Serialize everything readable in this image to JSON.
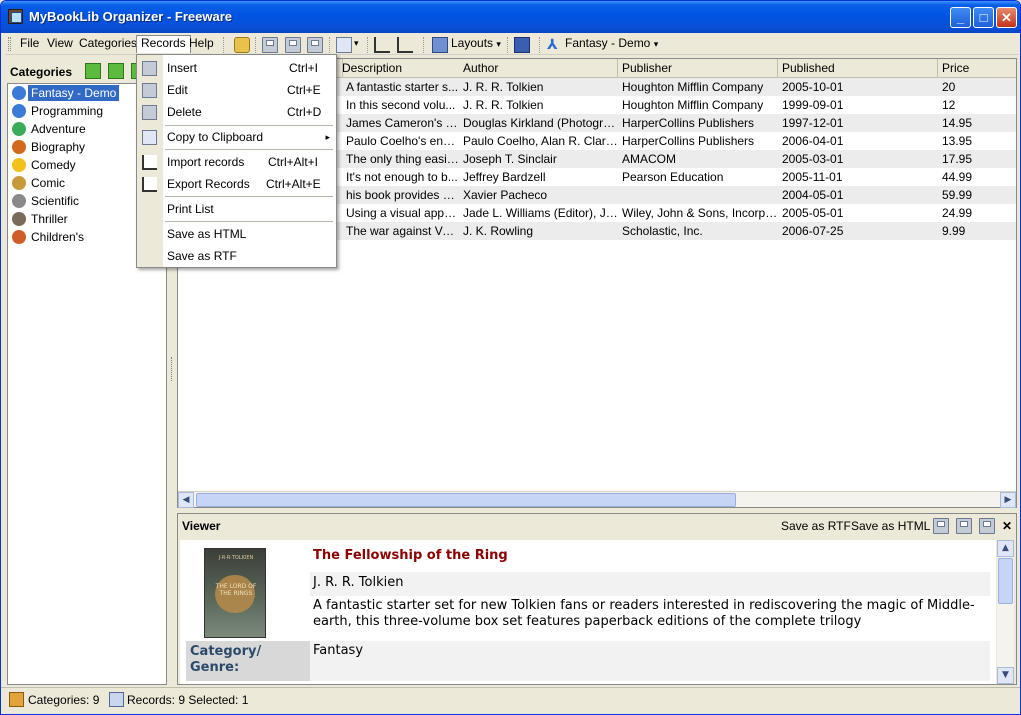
{
  "window": {
    "title": "MyBookLib Organizer - Freeware",
    "minimize": "_",
    "maximize": "□",
    "close": "✕"
  },
  "menu": {
    "file": "File",
    "view": "View",
    "categories": "Categories",
    "records": "Records",
    "help": "Help"
  },
  "toolbar": {
    "layouts": "Layouts",
    "layout_dropdown": "▾",
    "current_category": "Fantasy - Demo",
    "category_dropdown": "▾"
  },
  "left_panel": {
    "header": "Categories",
    "items": [
      {
        "label": "Fantasy - Demo",
        "selected": true,
        "icon": "fantasy-icon",
        "color": "#3b7ad6"
      },
      {
        "label": "Programming",
        "icon": "programming-icon",
        "color": "#3b7ad6"
      },
      {
        "label": "Adventure",
        "icon": "adventure-icon",
        "color": "#3bab5a"
      },
      {
        "label": "Biography",
        "icon": "biography-icon",
        "color": "#d26a1c"
      },
      {
        "label": "Comedy",
        "icon": "comedy-icon",
        "color": "#f2c21a"
      },
      {
        "label": "Comic",
        "icon": "comic-icon",
        "color": "#c49a3a"
      },
      {
        "label": "Scientific",
        "icon": "scientific-icon",
        "color": "#8a8a8a"
      },
      {
        "label": "Thriller",
        "icon": "thriller-icon",
        "color": "#7a6a5a"
      },
      {
        "label": "Children's",
        "icon": "childrens-icon",
        "color": "#d05c2a"
      }
    ]
  },
  "grid": {
    "columns": [
      "Description",
      "Author",
      "Publisher",
      "Published",
      "Price"
    ],
    "rows": [
      {
        "description": "A fantastic starter s...",
        "author": "J. R. R. Tolkien",
        "publisher": "Houghton Mifflin Company",
        "published": "2005-10-01",
        "price": "20"
      },
      {
        "description": "In this second volu...",
        "author": "J. R. R. Tolkien",
        "publisher": "Houghton Mifflin Company",
        "published": "1999-09-01",
        "price": "12"
      },
      {
        "description": "James Cameron's Ti...",
        "author": "Douglas Kirkland (Photograp...",
        "publisher": "HarperCollins Publishers",
        "published": "1997-12-01",
        "price": "14.95"
      },
      {
        "description": "Paulo Coelho's ench...",
        "author": "Paulo Coelho, Alan R. Clark...",
        "publisher": "HarperCollins Publishers",
        "published": "2006-04-01",
        "price": "13.95"
      },
      {
        "description": "The only thing easie...",
        "author": "Joseph T. Sinclair",
        "publisher": "AMACOM",
        "published": "2005-03-01",
        "price": "17.95"
      },
      {
        "description": "It's not enough to b...",
        "author": "Jeffrey Bardzell",
        "publisher": "Pearson Education",
        "published": "2005-11-01",
        "price": "44.99"
      },
      {
        "description": "his book provides e...",
        "author": "Xavier Pacheco",
        "publisher": "",
        "published": "2004-05-01",
        "price": "59.99"
      },
      {
        "description": "Using a visual appro...",
        "author": "Jade L. Williams (Editor), Ja...",
        "publisher": "Wiley, John & Sons, Incorpo...",
        "published": "2005-05-01",
        "price": "24.99"
      },
      {
        "description": "The war against Vol...",
        "author": "J. K. Rowling",
        "publisher": "Scholastic, Inc.",
        "published": "2006-07-25",
        "price": "9.99"
      }
    ]
  },
  "viewer": {
    "title": "Viewer",
    "save_rtf": "Save as RTF",
    "save_html": "Save as HTML",
    "close": "✕",
    "book_title": "The Fellowship of the Ring",
    "author": "J. R. R. Tolkien",
    "description": "A fantastic starter set for new Tolkien fans or readers interested in rediscovering the magic of Middle-earth, this three-volume box set features paperback editions of the complete trilogy",
    "category_label": "Category/ Genre:",
    "category_value": "Fantasy",
    "cover_author": "J·R·R·TOLKIEN",
    "cover_title": "THE LORD OF THE RINGS"
  },
  "records_menu": {
    "items": [
      {
        "label": "Insert",
        "shortcut": "Ctrl+I",
        "icon": "insert-icon"
      },
      {
        "label": "Edit",
        "shortcut": "Ctrl+E",
        "icon": "edit-icon"
      },
      {
        "label": "Delete",
        "shortcut": "Ctrl+D",
        "icon": "delete-icon"
      },
      {
        "label": "Copy to Clipboard",
        "shortcut": "",
        "icon": "copy-icon",
        "submenu": "▸"
      },
      {
        "label": "Import records",
        "shortcut": "Ctrl+Alt+I",
        "icon": "import-icon"
      },
      {
        "label": "Export Records",
        "shortcut": "Ctrl+Alt+E",
        "icon": "export-icon"
      },
      {
        "label": "Print List",
        "shortcut": ""
      },
      {
        "label": "Save as HTML",
        "shortcut": ""
      },
      {
        "label": "Save as RTF",
        "shortcut": ""
      }
    ]
  },
  "status": {
    "categories": "Categories: 9",
    "records": "Records: 9 Selected: 1"
  }
}
